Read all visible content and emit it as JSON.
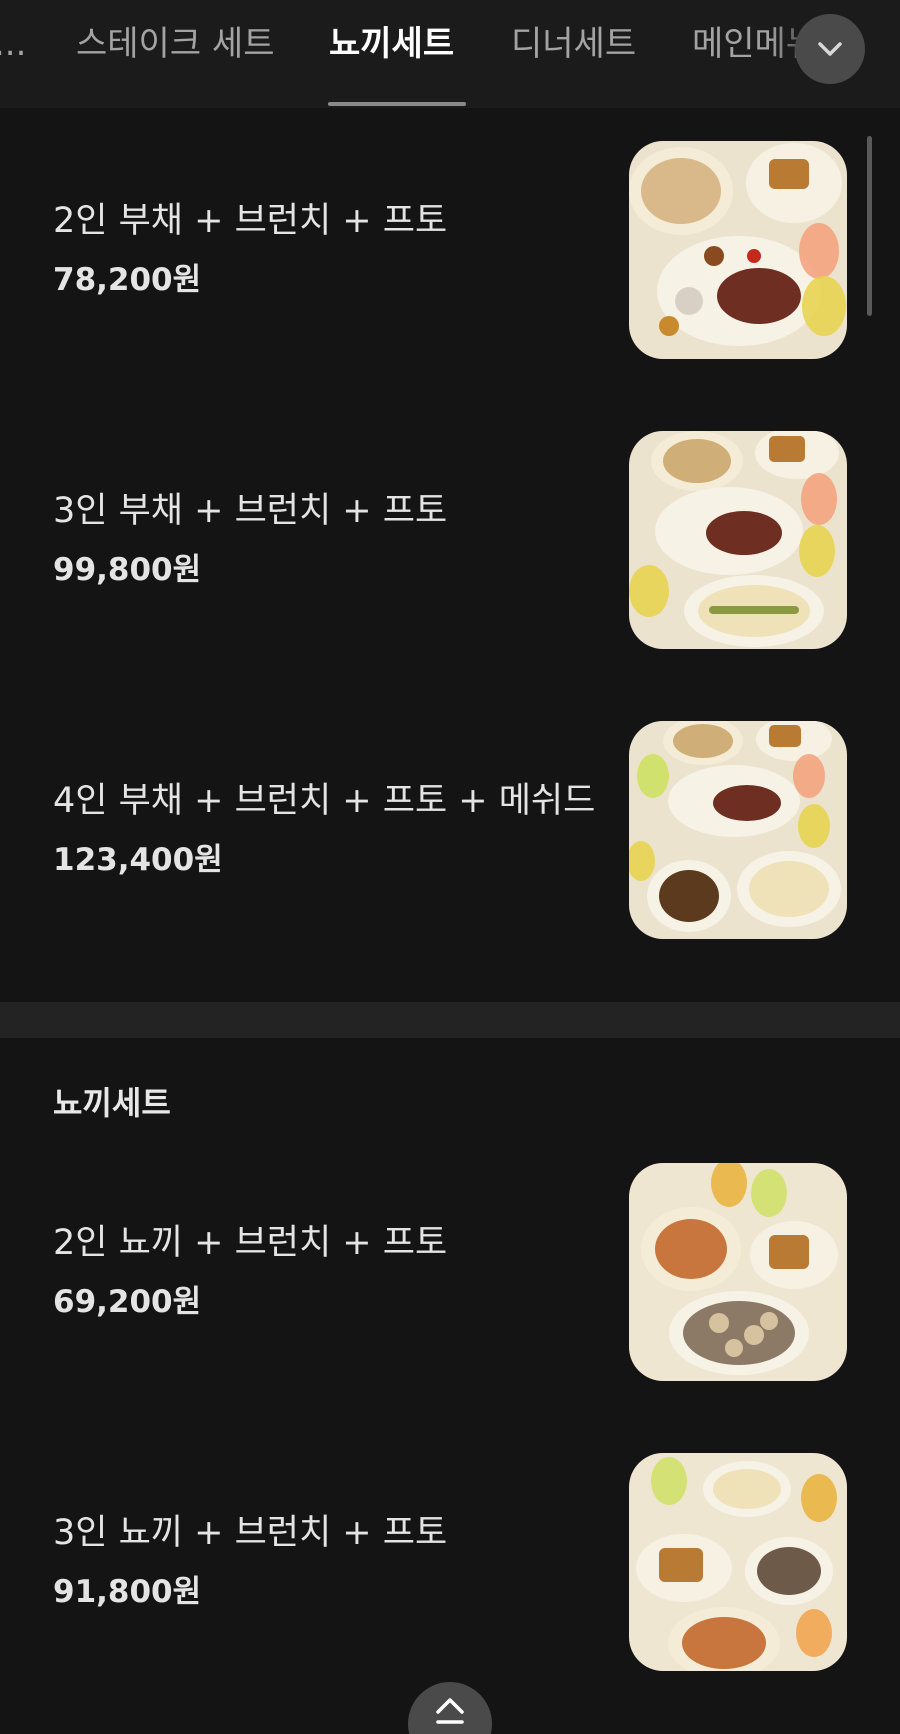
{
  "tabs": [
    {
      "label": "..."
    },
    {
      "label": "스테이크 세트"
    },
    {
      "label": "뇨끼세트",
      "active": true
    },
    {
      "label": "디너세트"
    },
    {
      "label": "메인메뉴"
    }
  ],
  "icons": {
    "dropdown": "chevron-down-icon",
    "scroll_top": "double-chevron-up-icon"
  },
  "colors": {
    "background": "#141414",
    "tabbar": "#1b1b1b",
    "active_tab": "#ffffff",
    "inactive_tab": "#a3a3a3"
  },
  "menus_top": [
    {
      "name": "2인 부채 + 브런치 + 프토",
      "price": "78,200원",
      "image": "food-photo-2-person-set"
    },
    {
      "name": "3인 부채 + 브런치 + 프토",
      "price": "99,800원",
      "image": "food-photo-3-person-set"
    },
    {
      "name": "4인 부채 + 브런치 + 프토 + 메쉬드",
      "price": "123,400원",
      "image": "food-photo-4-person-set"
    }
  ],
  "section": {
    "title": "뇨끼세트"
  },
  "menus_gnocchi": [
    {
      "name": "2인 뇨끼 + 브런치 + 프토",
      "price": "69,200원",
      "image": "food-photo-2-person-gnocchi"
    },
    {
      "name": "3인 뇨끼 + 브런치 + 프토",
      "price": "91,800원",
      "image": "food-photo-3-person-gnocchi"
    }
  ]
}
